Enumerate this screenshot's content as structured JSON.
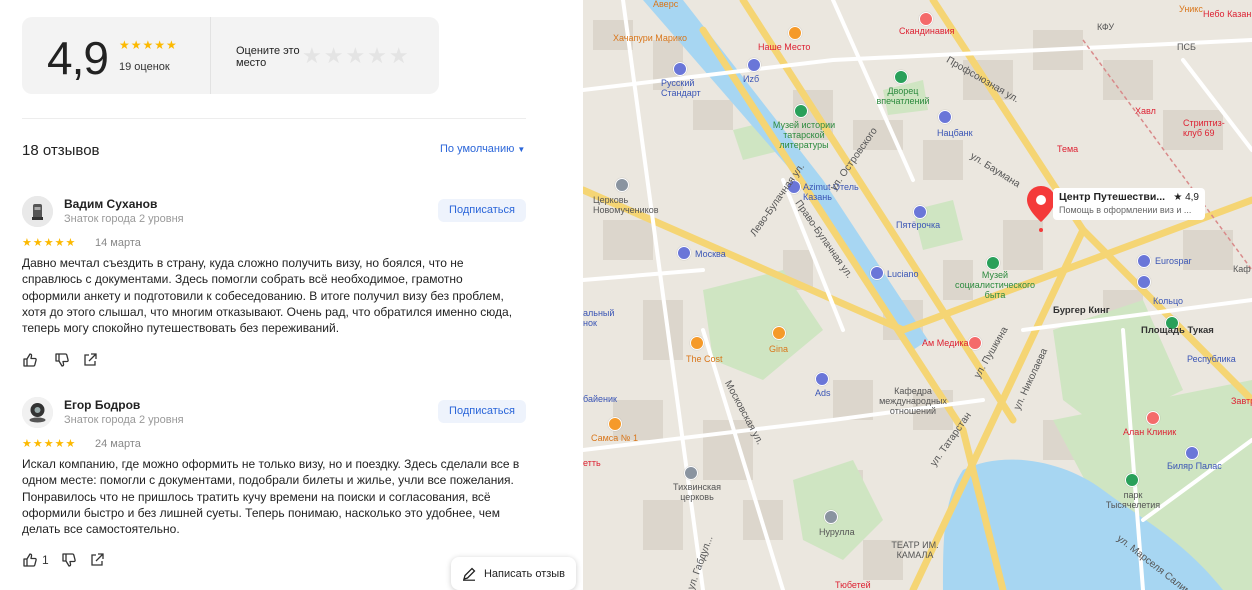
{
  "rating": {
    "value": "4,9",
    "stars": "★★★★★",
    "count_label": "19 оценок",
    "rate_label": "Оцените это место",
    "rate_stars": "★★★★★"
  },
  "reviews_header": {
    "count_label": "18 отзывов",
    "sort_label": "По умолчанию"
  },
  "reviews": [
    {
      "name": "Вадим Суханов",
      "level": "Знаток города 2 уровня",
      "subscribe_label": "Подписаться",
      "stars": "★★★★★",
      "date": "14 марта",
      "text": "Давно мечтал съездить в страну, куда сложно получить визу, но боялся, что не справлюсь с документами. Здесь помогли собрать всё необходимое, грамотно оформили анкету и подготовили к собеседованию. В итоге получил визу без проблем, хотя до этого слышал, что многим отказывают. Очень рад, что обратился именно сюда, теперь могу спокойно путешествовать без переживаний.",
      "likes": ""
    },
    {
      "name": "Егор Бодров",
      "level": "Знаток города 2 уровня",
      "subscribe_label": "Подписаться",
      "stars": "★★★★★",
      "date": "24 марта",
      "text": "Искал компанию, где можно оформить не только визу, но и поездку. Здесь сделали все в одном месте: помогли с документами, подобрали билеты и жилье, учли все пожелания. Понравилось что не пришлось тратить кучу времени на поиски и согласования, всё оформили быстро и без лишней суеты. Теперь понимаю, насколько это удобнее, чем делать все самостоятельно.",
      "likes": "1"
    }
  ],
  "write_review_label": "Написать отзыв",
  "map": {
    "marker": {
      "title": "Центр Путешестви...",
      "rating": "★ 4,9",
      "subtitle": "Помощь в оформлении виз и ..."
    },
    "labels": {
      "avers": "Аверс",
      "khachapuri": "Хачапури Марико",
      "nashe_mesto": "Наше Место",
      "izh": "Иzб",
      "russkiy": "Русский Стандарт",
      "skandinavia": "Скандинавия",
      "dvorets": "Дворец впечатлений",
      "muzey_tat": "Музей истории татарской литературы",
      "nats_bank": "Нацбанк",
      "tema": "Тема",
      "khavl": "Хавл",
      "striptiz": "Стриптиз-клуб 69",
      "kfu": "КФУ",
      "psb": "ПСБ",
      "unix": "Уникс",
      "nebo": "Небо Казани",
      "tserkov_nov": "Церковь Новомучеников",
      "azimut": "Azimut Отель Казань",
      "pyaterochka": "Пятёрочка",
      "moskva": "Москва",
      "luciano": "Luciano",
      "muzey_soc": "Музей социалистического быта",
      "burger": "Бургер Кинг",
      "eurospar": "Eurospar",
      "koltso": "Кольцо",
      "ploshad": "Площадь Тукая",
      "respublika": "Республика",
      "kaf": "Каф",
      "gina": "Gina",
      "the_cost": "The Cost",
      "am_medika": "Ам Медика",
      "kafedra": "Кафедра международных отношений",
      "ads": "Ads",
      "alan": "Алан Клиник",
      "bilyar": "Биляр Палас",
      "samsa": "Самса № 1",
      "tikhvin": "Тихвинская церковь",
      "nurulla": "Нурулла",
      "teatr": "ТЕАТР ИМ. КАМАЛА",
      "park": "парк Тысячелетия",
      "tyubetey": "Тюбетей",
      "zavtr": "Завтр",
      "alnyy": "альный нок",
      "baeynik": "байеник",
      "etti": "етть"
    },
    "streets": {
      "profsoyuznaya": "Профсоюзная ул.",
      "baumana": "ул. Баумана",
      "ostrovskogo": "ул. Островского",
      "pravo_bulach": "Право-Булачная ул.",
      "levo_bulach": "Лево-Булачная ул.",
      "pushkina": "ул. Пушкина",
      "nikolaeva": "ул. Николаева",
      "tatarstan": "ул. Татарстан",
      "moskovskaya": "Московская ул.",
      "gabdully": "ул. Габдул...",
      "marselya": "ул. Марселя Салим..."
    },
    "numbers": [
      "48",
      "2/39",
      "6А",
      "51",
      "57",
      "68",
      "70Д",
      "16/1",
      "44/1",
      "45/1",
      "82",
      "5/43",
      "53/2",
      "35",
      "44/1",
      "64А",
      "57/13",
      "18/1",
      "20А",
      "30",
      "15/25",
      "12"
    ]
  }
}
